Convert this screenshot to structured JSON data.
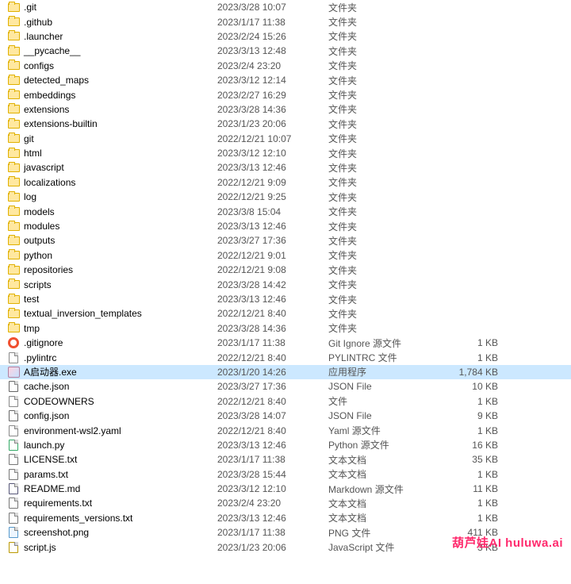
{
  "watermark": "葫芦娃AI  huluwa.ai",
  "icon_kinds": {
    "folder": "folder",
    "file": "file",
    "json": "file json",
    "txt": "file txt",
    "py": "file py",
    "yaml": "file yaml",
    "js": "file js",
    "md": "file md",
    "png": "file png",
    "exe": "exe",
    "gitignore": "gitignore"
  },
  "files": [
    {
      "icon": "folder",
      "name": ".git",
      "date": "2023/3/28 10:07",
      "type": "文件夹",
      "size": ""
    },
    {
      "icon": "folder",
      "name": ".github",
      "date": "2023/1/17 11:38",
      "type": "文件夹",
      "size": ""
    },
    {
      "icon": "folder",
      "name": ".launcher",
      "date": "2023/2/24 15:26",
      "type": "文件夹",
      "size": ""
    },
    {
      "icon": "folder",
      "name": "__pycache__",
      "date": "2023/3/13 12:48",
      "type": "文件夹",
      "size": ""
    },
    {
      "icon": "folder",
      "name": "configs",
      "date": "2023/2/4 23:20",
      "type": "文件夹",
      "size": ""
    },
    {
      "icon": "folder",
      "name": "detected_maps",
      "date": "2023/3/12 12:14",
      "type": "文件夹",
      "size": ""
    },
    {
      "icon": "folder",
      "name": "embeddings",
      "date": "2023/2/27 16:29",
      "type": "文件夹",
      "size": ""
    },
    {
      "icon": "folder",
      "name": "extensions",
      "date": "2023/3/28 14:36",
      "type": "文件夹",
      "size": ""
    },
    {
      "icon": "folder",
      "name": "extensions-builtin",
      "date": "2023/1/23 20:06",
      "type": "文件夹",
      "size": ""
    },
    {
      "icon": "folder",
      "name": "git",
      "date": "2022/12/21 10:07",
      "type": "文件夹",
      "size": ""
    },
    {
      "icon": "folder",
      "name": "html",
      "date": "2023/3/12 12:10",
      "type": "文件夹",
      "size": ""
    },
    {
      "icon": "folder",
      "name": "javascript",
      "date": "2023/3/13 12:46",
      "type": "文件夹",
      "size": ""
    },
    {
      "icon": "folder",
      "name": "localizations",
      "date": "2022/12/21 9:09",
      "type": "文件夹",
      "size": ""
    },
    {
      "icon": "folder",
      "name": "log",
      "date": "2022/12/21 9:25",
      "type": "文件夹",
      "size": ""
    },
    {
      "icon": "folder",
      "name": "models",
      "date": "2023/3/8 15:04",
      "type": "文件夹",
      "size": ""
    },
    {
      "icon": "folder",
      "name": "modules",
      "date": "2023/3/13 12:46",
      "type": "文件夹",
      "size": ""
    },
    {
      "icon": "folder",
      "name": "outputs",
      "date": "2023/3/27 17:36",
      "type": "文件夹",
      "size": ""
    },
    {
      "icon": "folder",
      "name": "python",
      "date": "2022/12/21 9:01",
      "type": "文件夹",
      "size": ""
    },
    {
      "icon": "folder",
      "name": "repositories",
      "date": "2022/12/21 9:08",
      "type": "文件夹",
      "size": ""
    },
    {
      "icon": "folder",
      "name": "scripts",
      "date": "2023/3/28 14:42",
      "type": "文件夹",
      "size": ""
    },
    {
      "icon": "folder",
      "name": "test",
      "date": "2023/3/13 12:46",
      "type": "文件夹",
      "size": ""
    },
    {
      "icon": "folder",
      "name": "textual_inversion_templates",
      "date": "2022/12/21 8:40",
      "type": "文件夹",
      "size": ""
    },
    {
      "icon": "folder",
      "name": "tmp",
      "date": "2023/3/28 14:36",
      "type": "文件夹",
      "size": ""
    },
    {
      "icon": "gitignore",
      "name": ".gitignore",
      "date": "2023/1/17 11:38",
      "type": "Git Ignore 源文件",
      "size": "1 KB"
    },
    {
      "icon": "file",
      "name": ".pylintrc",
      "date": "2022/12/21 8:40",
      "type": "PYLINTRC 文件",
      "size": "1 KB"
    },
    {
      "icon": "exe",
      "name": "A启动器.exe",
      "date": "2023/1/20 14:26",
      "type": "应用程序",
      "size": "1,784 KB",
      "selected": true
    },
    {
      "icon": "json",
      "name": "cache.json",
      "date": "2023/3/27 17:36",
      "type": "JSON File",
      "size": "10 KB"
    },
    {
      "icon": "file",
      "name": "CODEOWNERS",
      "date": "2022/12/21 8:40",
      "type": "文件",
      "size": "1 KB"
    },
    {
      "icon": "json",
      "name": "config.json",
      "date": "2023/3/28 14:07",
      "type": "JSON File",
      "size": "9 KB"
    },
    {
      "icon": "yaml",
      "name": "environment-wsl2.yaml",
      "date": "2022/12/21 8:40",
      "type": "Yaml 源文件",
      "size": "1 KB"
    },
    {
      "icon": "py",
      "name": "launch.py",
      "date": "2023/3/13 12:46",
      "type": "Python 源文件",
      "size": "16 KB"
    },
    {
      "icon": "txt",
      "name": "LICENSE.txt",
      "date": "2023/1/17 11:38",
      "type": "文本文档",
      "size": "35 KB"
    },
    {
      "icon": "txt",
      "name": "params.txt",
      "date": "2023/3/28 15:44",
      "type": "文本文档",
      "size": "1 KB"
    },
    {
      "icon": "md",
      "name": "README.md",
      "date": "2023/3/12 12:10",
      "type": "Markdown 源文件",
      "size": "11 KB"
    },
    {
      "icon": "txt",
      "name": "requirements.txt",
      "date": "2023/2/4 23:20",
      "type": "文本文档",
      "size": "1 KB"
    },
    {
      "icon": "txt",
      "name": "requirements_versions.txt",
      "date": "2023/3/13 12:46",
      "type": "文本文档",
      "size": "1 KB"
    },
    {
      "icon": "png",
      "name": "screenshot.png",
      "date": "2023/1/17 11:38",
      "type": "PNG 文件",
      "size": "411 KB"
    },
    {
      "icon": "js",
      "name": "script.js",
      "date": "2023/1/23 20:06",
      "type": "JavaScript 文件",
      "size": "3 KB"
    }
  ]
}
